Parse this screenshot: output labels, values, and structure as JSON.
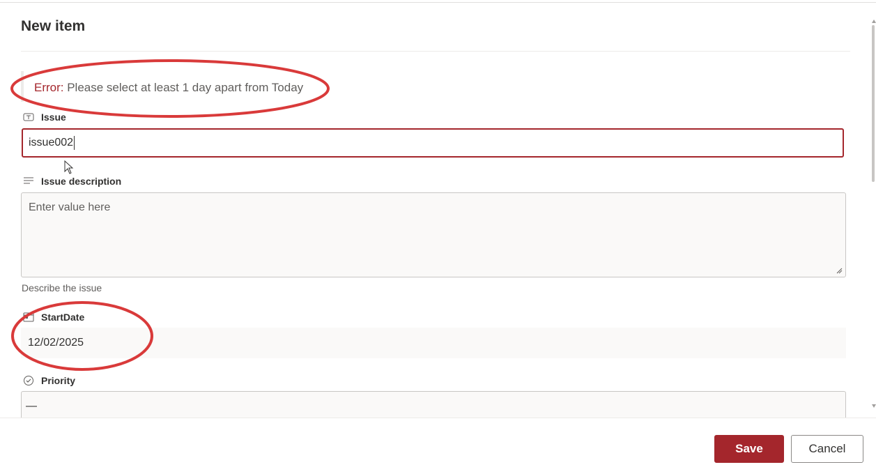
{
  "panel": {
    "title": "New item"
  },
  "error": {
    "prefix": "Error:",
    "message": " Please select at least 1 day apart from Today"
  },
  "fields": {
    "issue": {
      "label": "Issue",
      "value": "issue002",
      "icon": "text-field-icon"
    },
    "description": {
      "label": "Issue description",
      "placeholder": "Enter value here",
      "helper": "Describe the issue",
      "icon": "multiline-text-icon"
    },
    "start_date": {
      "label": "StartDate",
      "value": "12/02/2025",
      "icon": "calendar-icon"
    },
    "priority": {
      "label": "Priority",
      "value": "—",
      "icon": "choice-check-icon"
    }
  },
  "footer": {
    "save_label": "Save",
    "cancel_label": "Cancel"
  },
  "colors": {
    "accent": "#a4262c",
    "annotation": "#d93a3a",
    "field_bg": "#faf9f8"
  }
}
